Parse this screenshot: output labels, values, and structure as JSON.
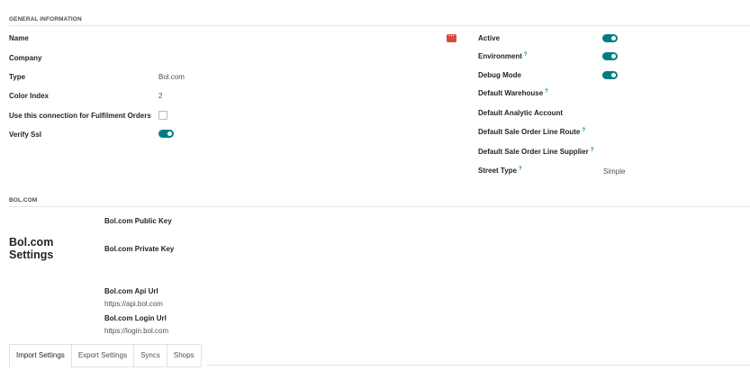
{
  "general": {
    "section_title": "GENERAL INFORMATION",
    "left": {
      "name_label": "Name",
      "company_label": "Company",
      "type_label": "Type",
      "type_value": "Bol.com",
      "color_index_label": "Color Index",
      "color_index_value": "2",
      "fulfilment_label": "Use this connection for Fulfilment Orders",
      "fulfilment_checked": false,
      "verify_ssl_label": "Verify Ssl",
      "verify_ssl_on": true
    },
    "right": {
      "active_label": "Active",
      "active_on": true,
      "environment_label": "Environment",
      "environment_on": true,
      "debug_label": "Debug Mode",
      "debug_on": true,
      "warehouse_label": "Default Warehouse",
      "analytic_label": "Default Analytic Account",
      "route_label": "Default Sale Order Line Route",
      "supplier_label": "Default Sale Order Line Supplier",
      "street_type_label": "Street Type",
      "street_type_value": "Simple"
    },
    "help_mark": "?",
    "more_icon": "more-horizontal-icon",
    "more_glyph": "···"
  },
  "bol": {
    "section_title": "BOL.COM",
    "settings_title": "Bol.com\nSettings",
    "public_key_label": "Bol.com Public Key",
    "private_key_label": "Bol.com Private Key",
    "api_url_label": "Bol.com Api Url",
    "api_url_value": "https://api.bol.com",
    "login_url_label": "Bol.com Login Url",
    "login_url_value": "https://login.bol.com"
  },
  "tabs": [
    {
      "label": "Import Settings",
      "active": true
    },
    {
      "label": "Export Settings",
      "active": false
    },
    {
      "label": "Syncs",
      "active": false
    },
    {
      "label": "Shops",
      "active": false
    }
  ],
  "colors": {
    "accent": "#017e84",
    "danger": "#d44c3b"
  }
}
